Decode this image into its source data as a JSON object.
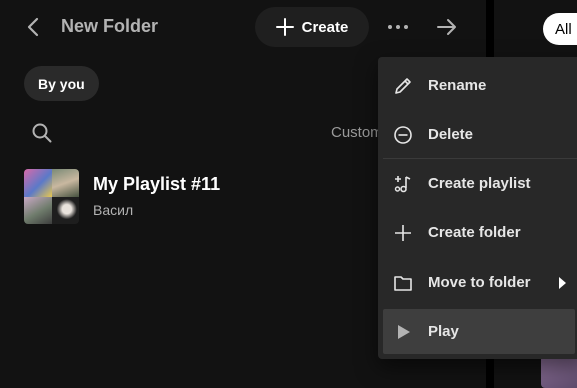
{
  "header": {
    "folder_title": "New Folder",
    "create_label": "Create",
    "back_icon": "chevron-left-icon",
    "more_icon": "more-horizontal-icon",
    "forward_icon": "arrow-right-icon"
  },
  "filters": {
    "chip_label": "By you"
  },
  "toolbar": {
    "sort_label": "Custom"
  },
  "library": {
    "items": [
      {
        "title": "My Playlist #11",
        "subtitle": "Васил"
      }
    ]
  },
  "right_panel": {
    "all_chip_label": "All"
  },
  "context_menu": {
    "items": [
      {
        "label": "Rename",
        "icon": "pencil-icon"
      },
      {
        "label": "Delete",
        "icon": "minus-circle-icon"
      },
      {
        "label": "Create playlist",
        "icon": "add-music-icon"
      },
      {
        "label": "Create folder",
        "icon": "plus-icon"
      },
      {
        "label": "Move to folder",
        "icon": "folder-icon",
        "has_submenu": true
      },
      {
        "label": "Play",
        "icon": "play-icon",
        "highlighted": true
      }
    ]
  },
  "colors": {
    "background": "#121212",
    "menu_background": "#282828",
    "menu_highlight": "#3e3e3e",
    "secondary_text": "#b3b3b3"
  }
}
